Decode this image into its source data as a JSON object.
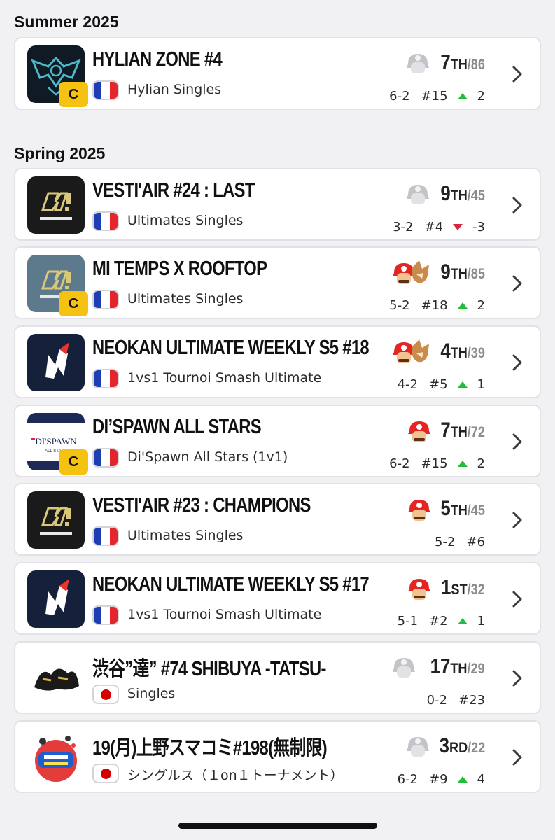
{
  "sections": [
    {
      "title": "Summer 2025"
    },
    {
      "title": "Spring 2025"
    }
  ],
  "tournaments": [
    {
      "name": "HYLIAN ZONE #4",
      "event": "Hylian Singles",
      "flag": "fr",
      "logo": "hylian",
      "c_badge": true,
      "badge_label": "C",
      "placing": "7",
      "suffix": "TH",
      "total": "/86",
      "record": "6-2",
      "seed": "#15",
      "trend": "up",
      "delta": "2",
      "character": "silhouette"
    },
    {
      "name": "VESTI'AIR #24 : LAST",
      "event": "Ultimates Singles",
      "flag": "fr",
      "logo": "vestiair",
      "c_badge": false,
      "badge_label": "",
      "placing": "9",
      "suffix": "TH",
      "total": "/45",
      "record": "3-2",
      "seed": "#4",
      "trend": "down",
      "delta": "-3",
      "character": "silhouette"
    },
    {
      "name": "MI TEMPS X ROOFTOP",
      "event": "Ultimates Singles",
      "flag": "fr",
      "logo": "rooftop",
      "c_badge": true,
      "badge_label": "C",
      "placing": "9",
      "suffix": "TH",
      "total": "/85",
      "record": "5-2",
      "seed": "#18",
      "trend": "up",
      "delta": "2",
      "character": "mario-fox"
    },
    {
      "name": "NEOKAN ULTIMATE WEEKLY S5 #18",
      "event": "1vs1 Tournoi Smash Ultimate",
      "flag": "fr",
      "logo": "neokan",
      "c_badge": false,
      "badge_label": "",
      "placing": "4",
      "suffix": "TH",
      "total": "/39",
      "record": "4-2",
      "seed": "#5",
      "trend": "up",
      "delta": "1",
      "character": "mario-fox"
    },
    {
      "name": "DI’SPAWN ALL STARS",
      "event": "Di'Spawn All Stars (1v1)",
      "flag": "fr",
      "logo": "dispawn",
      "c_badge": true,
      "badge_label": "C",
      "logo_text": "DI'SPAWN",
      "logo_subtext": "ALL STARS",
      "placing": "7",
      "suffix": "TH",
      "total": "/72",
      "record": "6-2",
      "seed": "#15",
      "trend": "up",
      "delta": "2",
      "character": "mario"
    },
    {
      "name": "VESTI'AIR #23 : CHAMPIONS",
      "event": "Ultimates Singles",
      "flag": "fr",
      "logo": "vestiair",
      "c_badge": false,
      "badge_label": "",
      "placing": "5",
      "suffix": "TH",
      "total": "/45",
      "record": "5-2",
      "seed": "#6",
      "trend": "none",
      "delta": "",
      "character": "mario"
    },
    {
      "name": "NEOKAN ULTIMATE WEEKLY S5 #17",
      "event": "1vs1 Tournoi Smash Ultimate",
      "flag": "fr",
      "logo": "neokan",
      "c_badge": false,
      "badge_label": "",
      "placing": "1",
      "suffix": "ST",
      "total": "/32",
      "record": "5-1",
      "seed": "#2",
      "trend": "up",
      "delta": "1",
      "character": "mario"
    },
    {
      "name": "渋谷”達” #74 SHIBUYA -TATSU-",
      "event": "Singles",
      "flag": "jp",
      "logo": "tatsu",
      "c_badge": false,
      "badge_label": "",
      "placing": "17",
      "suffix": "TH",
      "total": "/29",
      "record": "0-2",
      "seed": "#23",
      "trend": "none",
      "delta": "",
      "character": "silhouette"
    },
    {
      "name": "19(月)上野スマコミ#198(無制限)",
      "event": "シングルス（１on１トーナメント）",
      "flag": "jp",
      "logo": "ueno",
      "c_badge": false,
      "badge_label": "",
      "placing": "3",
      "suffix": "RD",
      "total": "/22",
      "record": "6-2",
      "seed": "#9",
      "trend": "up",
      "delta": "4",
      "character": "silhouette"
    }
  ],
  "colors": {
    "badge": "#f5c211",
    "trend_up": "#1fbf3a",
    "trend_down": "#d7263d"
  }
}
